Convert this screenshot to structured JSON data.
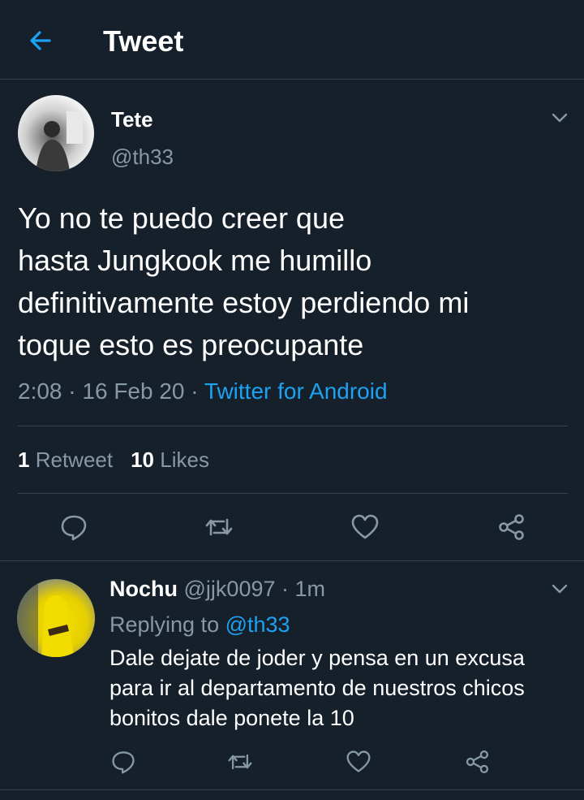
{
  "header": {
    "title": "Tweet"
  },
  "tweet": {
    "author_name": "Tete",
    "author_handle": "@th33",
    "text": "Yo no te puedo creer que\nhasta Jungkook me humillo\ndefinitivamente estoy perdiendo mi\ntoque esto es preocupante",
    "time": "2:08",
    "date": "16 Feb 20",
    "separator": "·",
    "source": "Twitter for Android",
    "retweet_count": "1",
    "retweet_label": "Retweet",
    "like_count": "10",
    "like_label": "Likes"
  },
  "reply": {
    "author_name": "Nochu",
    "author_handle": "@jjk0097",
    "time_ago": "· 1m",
    "replying_prefix": "Replying to",
    "replying_mention": "@th33",
    "text": "Dale dejate de joder y pensa en un excusa\npara ir al departamento de nuestros chicos\nbonitos dale ponete la 10"
  },
  "colors": {
    "background": "#15202b",
    "divider": "#38444d",
    "accent": "#1da1f2",
    "muted": "#8899a6"
  },
  "icons": [
    "back-arrow-icon",
    "chevron-down-icon",
    "reply-icon",
    "retweet-icon",
    "like-icon",
    "share-icon"
  ]
}
